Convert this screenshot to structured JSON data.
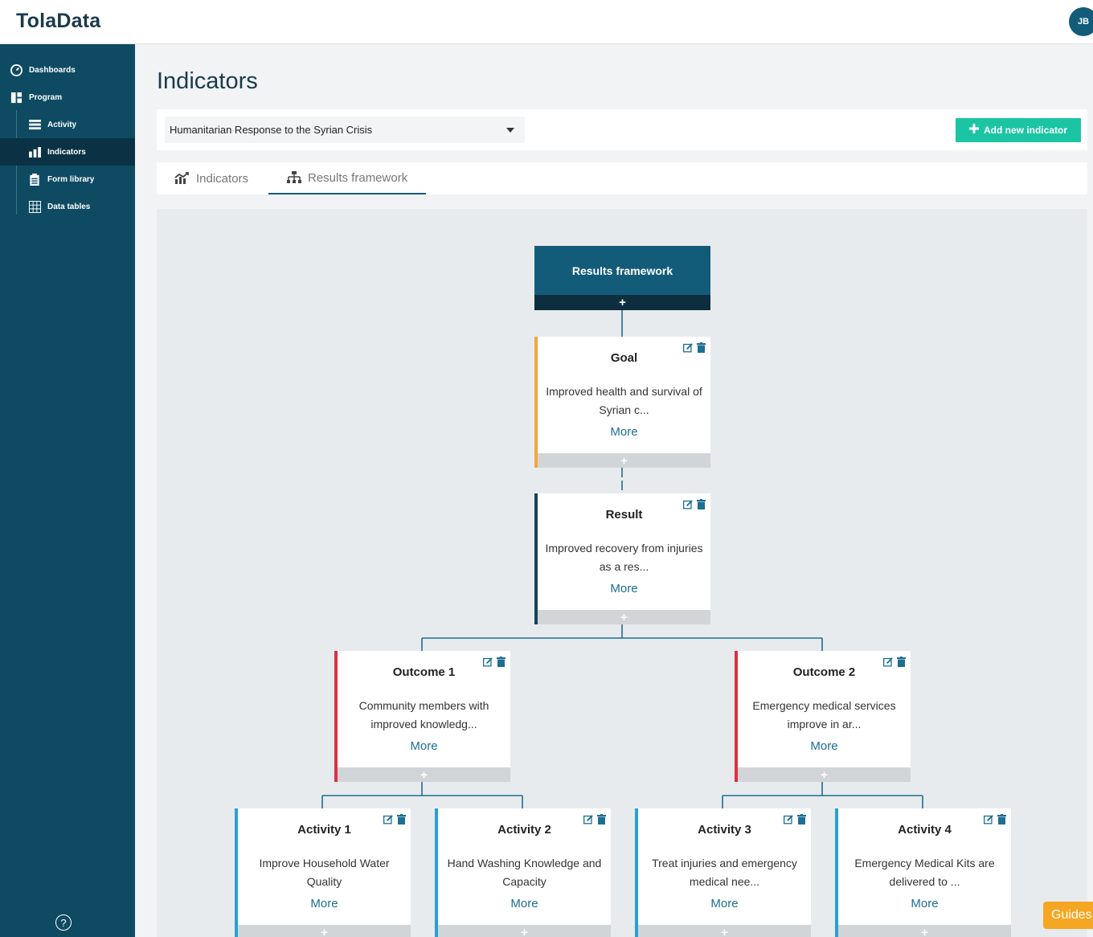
{
  "app": {
    "logo": "TolaData",
    "user_initials": "JB"
  },
  "sidebar": {
    "items": [
      {
        "label": "Dashboards",
        "icon": "dashboard-icon"
      },
      {
        "label": "Program",
        "icon": "program-icon"
      },
      {
        "label": "Activity",
        "icon": "activity-icon"
      },
      {
        "label": "Indicators",
        "icon": "indicators-icon",
        "active": true
      },
      {
        "label": "Form library",
        "icon": "form-library-icon"
      },
      {
        "label": "Data tables",
        "icon": "data-tables-icon"
      }
    ],
    "help": "?"
  },
  "page": {
    "title": "Indicators"
  },
  "filter": {
    "program": "Humanitarian Response to the Syrian Crisis",
    "add_button": "Add new indicator"
  },
  "tabs": [
    {
      "label": "Indicators",
      "icon": "indicators-chart-icon",
      "active": false
    },
    {
      "label": "Results framework",
      "icon": "hierarchy-icon",
      "active": true
    }
  ],
  "framework": {
    "root": {
      "title": "Results framework",
      "add": "+"
    },
    "goal": {
      "title": "Goal",
      "desc": "Improved health and survival of Syrian c...",
      "more": "More"
    },
    "result": {
      "title": "Result",
      "desc": "Improved recovery from injuries as a res...",
      "more": "More"
    },
    "outcomes": [
      {
        "title": "Outcome 1",
        "desc": "Community members with improved knowledg...",
        "more": "More"
      },
      {
        "title": "Outcome 2",
        "desc": "Emergency medical services improve in ar...",
        "more": "More"
      }
    ],
    "activities": [
      {
        "title": "Activity 1",
        "desc": "Improve Household Water Quality",
        "more": "More"
      },
      {
        "title": "Activity 2",
        "desc": "Hand Washing Knowledge and Capacity",
        "more": "More"
      },
      {
        "title": "Activity 3",
        "desc": "Treat injuries and emergency medical nee...",
        "more": "More"
      },
      {
        "title": "Activity 4",
        "desc": "Emergency Medical Kits are delivered to ...",
        "more": "More"
      }
    ]
  },
  "guides": {
    "label": "Guides"
  },
  "colors": {
    "brand": "#0e4b63",
    "accent": "#1bc5a4",
    "goal": "#f3a73b",
    "result": "#12445a",
    "outcome": "#df2f3f",
    "activity": "#2b9fd2"
  }
}
